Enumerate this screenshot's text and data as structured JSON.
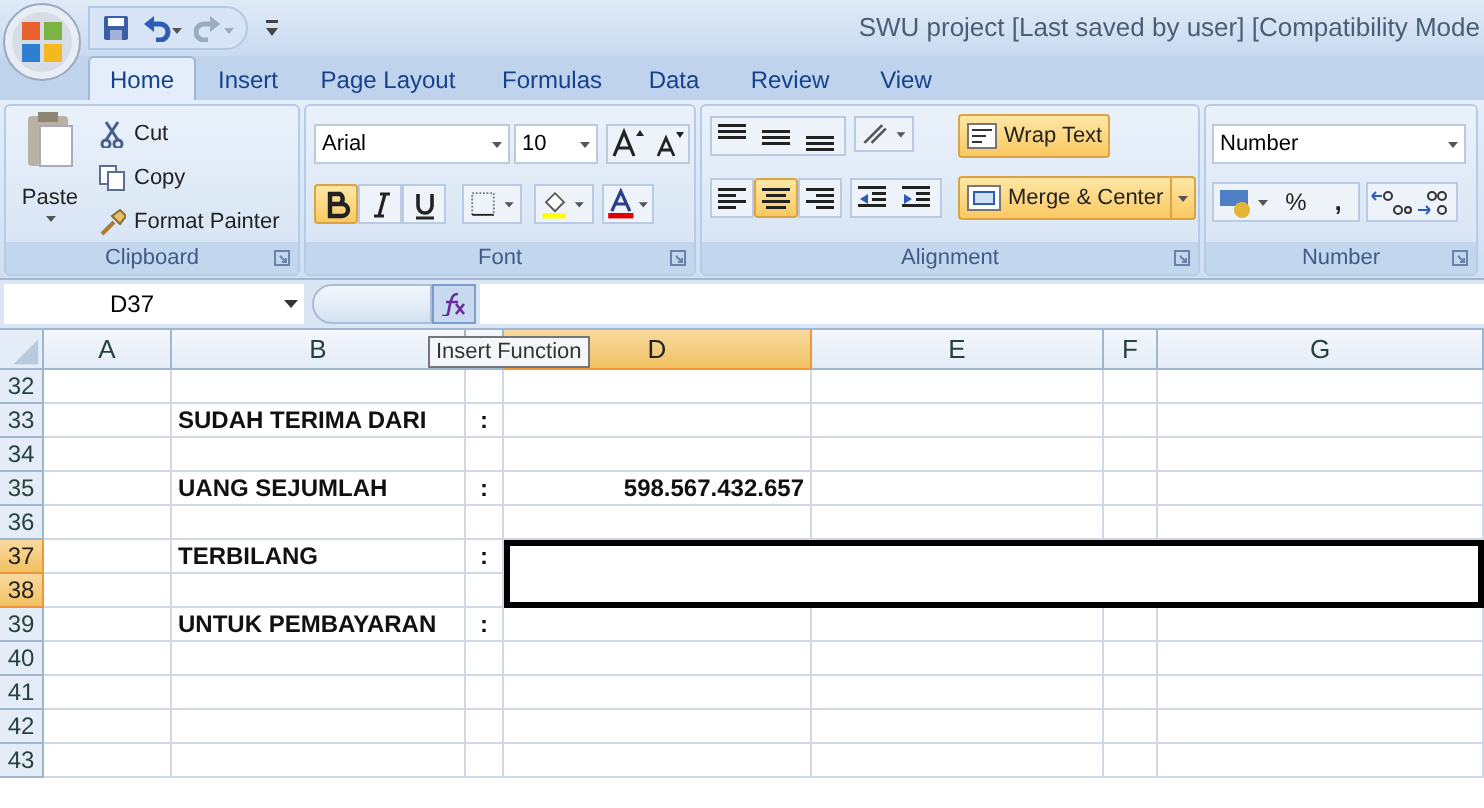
{
  "window": {
    "title": "SWU project [Last saved by user]  [Compatibility Mode"
  },
  "tabs": [
    {
      "label": "Home",
      "selected": true
    },
    {
      "label": "Insert",
      "selected": false
    },
    {
      "label": "Page Layout",
      "selected": false
    },
    {
      "label": "Formulas",
      "selected": false
    },
    {
      "label": "Data",
      "selected": false
    },
    {
      "label": "Review",
      "selected": false
    },
    {
      "label": "View",
      "selected": false
    }
  ],
  "clipboard": {
    "paste": "Paste",
    "cut": "Cut",
    "copy": "Copy",
    "format_painter": "Format Painter",
    "label": "Clipboard"
  },
  "font": {
    "font_name": "Arial",
    "font_size": "10",
    "bold": true,
    "italic": false,
    "underline": false,
    "label": "Font"
  },
  "alignment": {
    "align_left": false,
    "align_center": true,
    "align_right": false,
    "wrap_text": {
      "label": "Wrap Text",
      "on": true
    },
    "merge_center": {
      "label": "Merge & Center",
      "on": true
    },
    "label": "Alignment"
  },
  "number": {
    "format": "Number",
    "percent": "%",
    "comma": ",",
    "label": "Number"
  },
  "formula_bar": {
    "name_box": "D37",
    "tooltip": "Insert Function"
  },
  "columns": [
    {
      "label": "A",
      "selected": false
    },
    {
      "label": "B",
      "selected": false
    },
    {
      "selected": false
    },
    {
      "label": "D",
      "selected": true
    },
    {
      "label": "E",
      "selected": false
    },
    {
      "label": "F",
      "selected": false
    },
    {
      "label": "G",
      "selected": false
    }
  ],
  "rows": [
    {
      "number": "32",
      "selected": false
    },
    {
      "number": "33",
      "selected": false,
      "label": "SUDAH TERIMA DARI",
      "colon": ":"
    },
    {
      "number": "34",
      "selected": false
    },
    {
      "number": "35",
      "selected": false,
      "label": "UANG SEJUMLAH",
      "colon": ":",
      "value": "598.567.432.657"
    },
    {
      "number": "36",
      "selected": false
    },
    {
      "number": "37",
      "selected": true,
      "label": "TERBILANG",
      "colon": ":"
    },
    {
      "number": "38",
      "selected": true
    },
    {
      "number": "39",
      "selected": false,
      "label": "UNTUK PEMBAYARAN",
      "colon": ":"
    },
    {
      "number": "40",
      "selected": false
    },
    {
      "number": "41",
      "selected": false
    },
    {
      "number": "42",
      "selected": false
    },
    {
      "number": "43",
      "selected": false
    }
  ]
}
